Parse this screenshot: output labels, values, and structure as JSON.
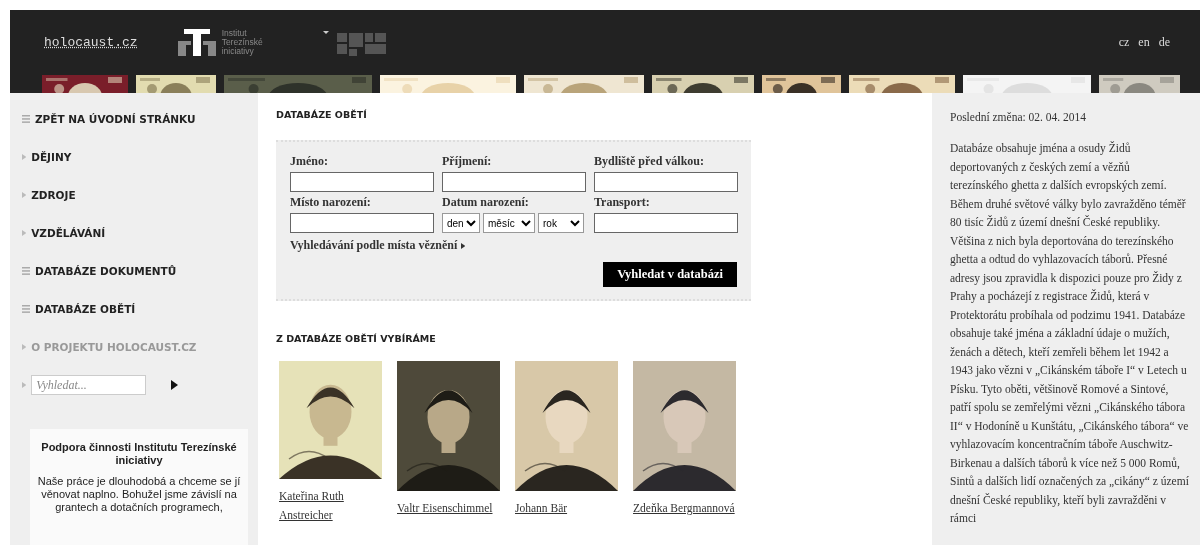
{
  "header": {
    "site_link": "holocaust.cz",
    "institute_name": [
      "Institut",
      "Terezínské",
      "iniciativy"
    ],
    "languages": [
      {
        "label": "cz",
        "selected": false
      },
      {
        "label": "en",
        "selected": false
      },
      {
        "label": "de",
        "selected": false
      }
    ],
    "thumbnails": [
      {
        "kind": "picture"
      },
      {
        "kind": "picture"
      },
      {
        "kind": "picture"
      },
      {
        "kind": "picture"
      },
      {
        "kind": "picture"
      },
      {
        "kind": "picture"
      },
      {
        "kind": "picture"
      },
      {
        "kind": "picture"
      },
      {
        "kind": "picture"
      },
      {
        "kind": "picture"
      }
    ]
  },
  "sidebar": {
    "items": [
      {
        "label": "ZPĚT NA ÚVODNÍ STRÁNKU",
        "kind": "list",
        "dimmed": false
      },
      {
        "label": "DĚJINY",
        "kind": "arrow",
        "dimmed": false
      },
      {
        "label": "ZDROJE",
        "kind": "arrow",
        "dimmed": false
      },
      {
        "label": "VZDĚLÁVÁNÍ",
        "kind": "arrow",
        "dimmed": false
      },
      {
        "label": "DATABÁZE DOKUMENTŮ",
        "kind": "list",
        "dimmed": false
      },
      {
        "label": "DATABÁZE OBĚTÍ",
        "kind": "list",
        "dimmed": false
      },
      {
        "label": "O PROJEKTU HOLOCAUST.CZ",
        "kind": "arrow",
        "dimmed": true
      }
    ],
    "search": {
      "placeholder": "Vyhledat..."
    },
    "support": {
      "title": "Podpora činnosti Institutu Terezínské iniciativy",
      "text": "Naše práce je dlouhodobá a chceme se jí věnovat naplno. Bohužel jsme závislí na grantech a dotačních programech,"
    }
  },
  "main": {
    "title": "DATABÁZE OBĚTÍ",
    "form": {
      "fields": [
        {
          "label": "Jméno:",
          "kind": "text"
        },
        {
          "label": "Příjmení:",
          "kind": "text"
        },
        {
          "label": "Bydliště před válkou:",
          "kind": "text"
        },
        {
          "label": "Místo narození:",
          "kind": "text"
        },
        {
          "label": "Datum narození:",
          "kind": "date",
          "selects": [
            "den",
            "měsíc",
            "rok"
          ]
        },
        {
          "label": "Transport:",
          "kind": "text"
        }
      ],
      "prison_link": "Vyhledávání podle místa věznění",
      "submit": "Vyhledat v databázi"
    },
    "featured_title": "Z DATABÁZE OBĚTÍ VYBÍRÁME",
    "people": [
      {
        "name": "Kateřina Ruth Anstreicher",
        "photo": {
          "kind": "picture"
        }
      },
      {
        "name": "Valtr Eisenschimmel",
        "photo": {
          "kind": "picture"
        }
      },
      {
        "name": "Johann Bär",
        "photo": {
          "kind": "picture"
        }
      },
      {
        "name": "Zdeňka Bergmannová",
        "photo": {
          "kind": "picture"
        }
      }
    ]
  },
  "aside": {
    "last_change": "Poslední změna: 02. 04. 2014",
    "text": "Databáze obsahuje jména a osudy Židů deportovaných z českých zemí a vězňů terezínského ghetta z dalších evropských zemí. Během druhé světové války bylo zavražděno téměř 80 tisíc Židů z území dnešní České republiky. Většina z nich byla deportována do terezínského ghetta a odtud do vyhlazovacích táborů. Přesné adresy jsou zpravidla k dispozici pouze pro Židy z Prahy a pocházejí z registrace Židů, která v Protektorátu probíhala od podzimu 1941. Databáze obsahuje také jména a základní údaje o mužích, ženách a dětech, kteří zemřeli během let 1942 a 1943 jako vězni v „Cikánském táboře I“ v Letech u Písku. Tyto oběti, většinově Romové a Sintové, patří spolu se zemřelými vězni „Cikánského tábora II“ v Hodoníně u Kunštátu, „Cikánského tábora“ ve vyhlazovacím koncentračním táboře Auschwitz-Birkenau a dalších táborů k více než 5 000 Romů, Sintů a dalších lidí označených za „cikány“ z území dnešní České republiky, kteří byli zavražděni v rámci"
  }
}
